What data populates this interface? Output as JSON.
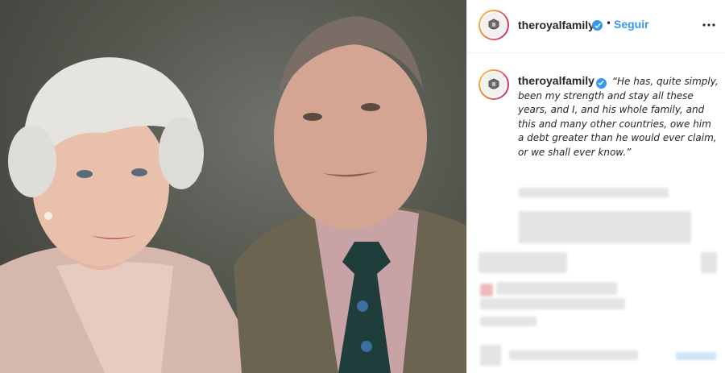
{
  "post": {
    "account": "theroyalfamily",
    "follow_label": "Seguir",
    "more_label": "...",
    "caption_text": "“He has, quite simply, been my strength and stay all these years, and I, and his whole family, and this and many other countries, owe him a debt greater than he would ever claim, or we shall ever know.”"
  },
  "icons": {
    "verified": "verified-badge-icon",
    "more": "more-options-icon",
    "avatar": "royal-crest-icon"
  },
  "colors": {
    "accent": "#3897f0",
    "text": "#262626",
    "border": "#efefef"
  }
}
